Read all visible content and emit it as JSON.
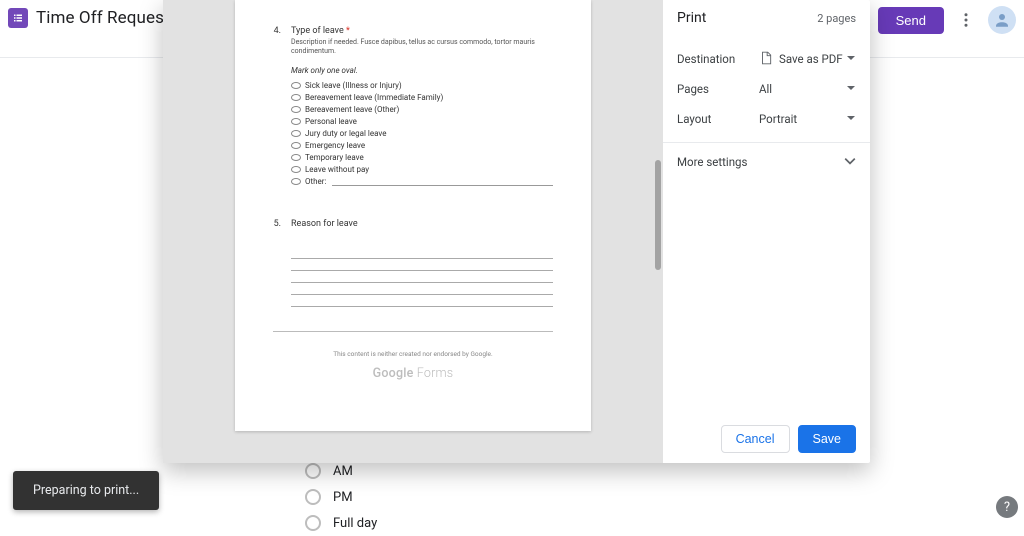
{
  "header": {
    "doc_title": "Time Off Request",
    "send_label": "Send"
  },
  "bg_form": {
    "options": [
      "AM",
      "PM",
      "Full day"
    ]
  },
  "preview": {
    "q4": {
      "number": "4.",
      "title": "Type of leave",
      "required_marker": "*",
      "description": "Description if needed. Fusce dapibus, tellus ac cursus commodo, tortor mauris condimentum.",
      "hint": "Mark only one oval.",
      "options": [
        "Sick leave (Illness or Injury)",
        "Bereavement leave (Immediate Family)",
        "Bereavement leave (Other)",
        "Personal leave",
        "Jury duty or legal leave",
        "Emergency leave",
        "Temporary leave",
        "Leave without pay"
      ],
      "other_label": "Other:"
    },
    "q5": {
      "number": "5.",
      "title": "Reason for leave"
    },
    "disclaimer": "This content is neither created nor endorsed by Google.",
    "logo_left": "Google",
    "logo_right": " Forms"
  },
  "print": {
    "title": "Print",
    "page_count": "2 pages",
    "rows": {
      "destination_label": "Destination",
      "destination_value": "Save as PDF",
      "pages_label": "Pages",
      "pages_value": "All",
      "layout_label": "Layout",
      "layout_value": "Portrait"
    },
    "more_settings": "More settings",
    "cancel": "Cancel",
    "save": "Save"
  },
  "toast": "Preparing to print...",
  "help": "?"
}
